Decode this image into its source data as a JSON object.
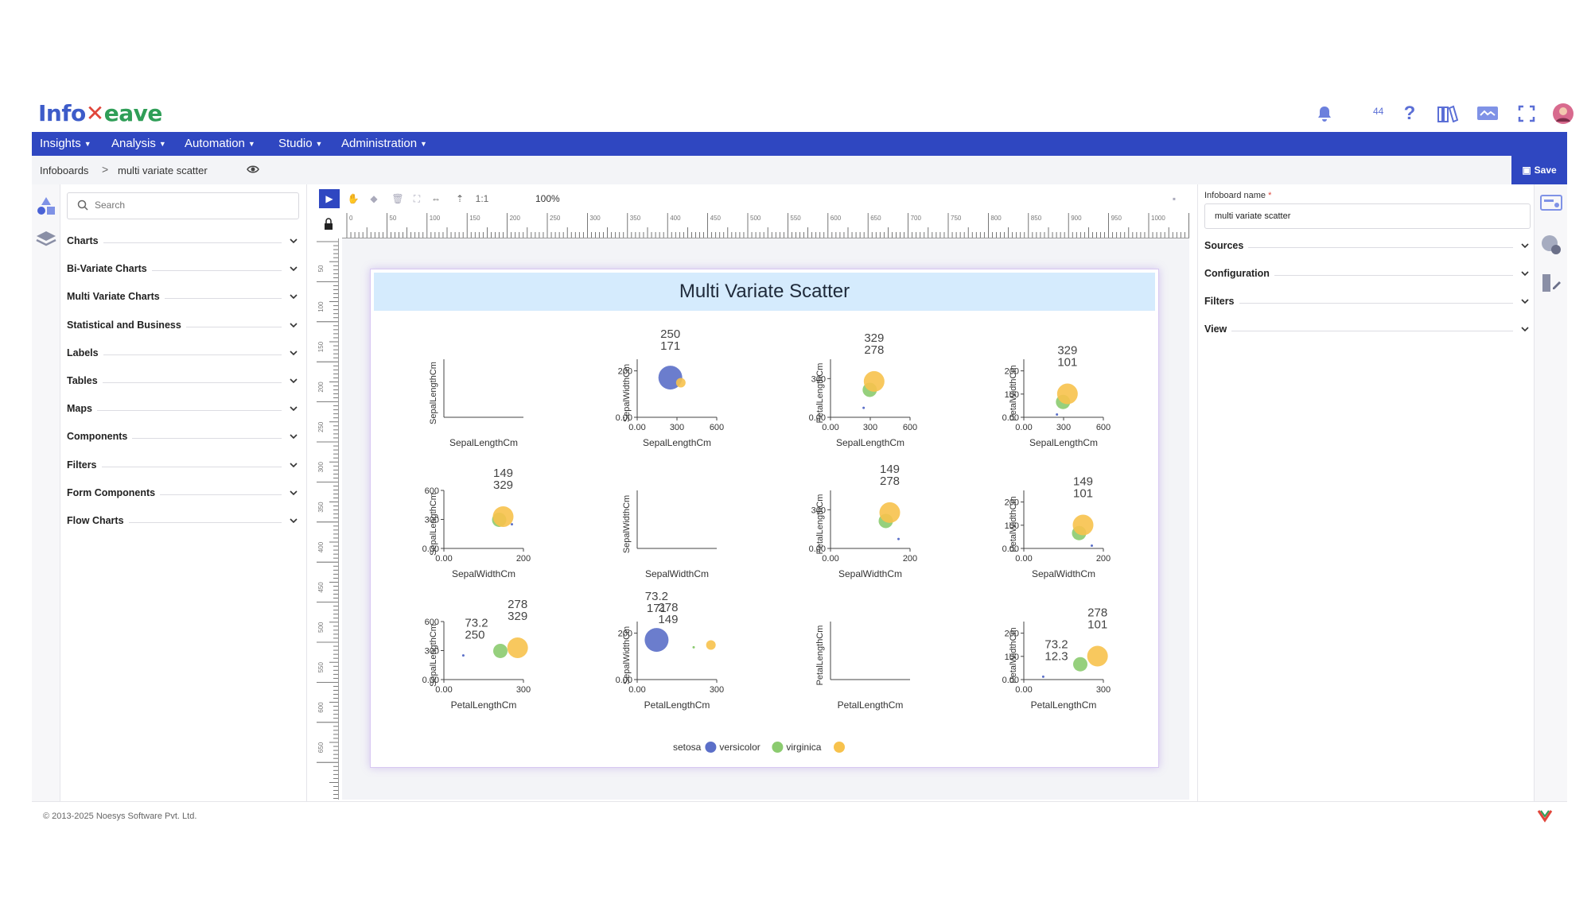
{
  "app": {
    "logo_text_1": "Info",
    "logo_text_2": "eave",
    "notification_count": "44"
  },
  "menu": [
    {
      "label": "Insights"
    },
    {
      "label": "Analysis"
    },
    {
      "label": "Automation"
    },
    {
      "label": "Studio"
    },
    {
      "label": "Administration"
    }
  ],
  "breadcrumb": {
    "root": "Infoboards",
    "separator": ">",
    "current": "multi variate scatter"
  },
  "save_label": "Save",
  "left_panel": {
    "search_placeholder": "Search",
    "categories": [
      "Charts",
      "Bi-Variate Charts",
      "Multi Variate Charts",
      "Statistical and Business",
      "Labels",
      "Tables",
      "Maps",
      "Components",
      "Filters",
      "Form Components",
      "Flow Charts"
    ]
  },
  "toolbar": {
    "ratio_label": "1:1",
    "zoom": "100%"
  },
  "rulers": {
    "h_ticks": [
      "0",
      "50",
      "100",
      "150",
      "200",
      "250",
      "300",
      "350",
      "400",
      "450",
      "500",
      "550",
      "600",
      "650",
      "700",
      "750",
      "800",
      "850",
      "900",
      "950",
      "1000"
    ],
    "v_ticks": [
      "50",
      "100",
      "150",
      "200",
      "250",
      "300",
      "350",
      "400",
      "450",
      "500",
      "550",
      "600",
      "650"
    ]
  },
  "right_panel": {
    "infoboard_name_label": "Infoboard name",
    "required_mark": "*",
    "infoboard_name_value": "multi variate scatter",
    "sections": [
      "Sources",
      "Configuration",
      "Filters",
      "View"
    ]
  },
  "footer": {
    "copyright": "© 2013-2025 Noesys Software Pvt. Ltd."
  },
  "chart_data": {
    "type": "scatter",
    "title": "Multi Variate Scatter",
    "variables": [
      "SepalLengthCm",
      "SepalWidthCm",
      "PetalLengthCm",
      "PetalWidthCm"
    ],
    "colors": {
      "setosa": "#5b6fc8",
      "versicolor": "#8bcb6f",
      "virginica": "#f7c24d"
    },
    "legend": [
      {
        "name": "setosa",
        "color": "#5b6fc8"
      },
      {
        "name": "versicolor",
        "color": "#8bcb6f"
      },
      {
        "name": "virginica",
        "color": "#f7c24d"
      }
    ],
    "panels": [
      {
        "row": 0,
        "col": 0,
        "xlabel": "SepalLengthCm",
        "ylabel": "SepalLengthCm",
        "empty": true
      },
      {
        "row": 0,
        "col": 1,
        "xlabel": "SepalLengthCm",
        "ylabel": "SepalWidthCm",
        "xticks": [
          "0.00",
          "300",
          "600"
        ],
        "yticks": [
          "0.00",
          "200"
        ],
        "xlim": [
          0,
          600
        ],
        "ylim": [
          0,
          250
        ],
        "labels": [
          "250",
          "171"
        ],
        "points": [
          {
            "species": "setosa",
            "x": 250,
            "y": 171,
            "r": 15
          },
          {
            "species": "virginica",
            "x": 329,
            "y": 149,
            "r": 6
          }
        ]
      },
      {
        "row": 0,
        "col": 2,
        "xlabel": "SepalLengthCm",
        "ylabel": "PetalLengthCm",
        "xticks": [
          "0.00",
          "300",
          "600"
        ],
        "yticks": [
          "0.00",
          "300"
        ],
        "xlim": [
          0,
          600
        ],
        "ylim": [
          0,
          450
        ],
        "labels": [
          "329",
          "278"
        ],
        "points": [
          {
            "species": "versicolor",
            "x": 296,
            "y": 213,
            "r": 9
          },
          {
            "species": "virginica",
            "x": 329,
            "y": 278,
            "r": 13
          },
          {
            "species": "setosa",
            "x": 250,
            "y": 73,
            "r": 1.5
          }
        ]
      },
      {
        "row": 0,
        "col": 3,
        "xlabel": "SepalLengthCm",
        "ylabel": "PetalWidthCm",
        "xticks": [
          "0.00",
          "300",
          "600"
        ],
        "yticks": [
          "0.00",
          "100",
          "200"
        ],
        "xlim": [
          0,
          600
        ],
        "ylim": [
          0,
          250
        ],
        "labels": [
          "329",
          "101"
        ],
        "points": [
          {
            "species": "versicolor",
            "x": 296,
            "y": 66,
            "r": 9
          },
          {
            "species": "virginica",
            "x": 329,
            "y": 101,
            "r": 13
          },
          {
            "species": "setosa",
            "x": 250,
            "y": 12,
            "r": 1.5
          }
        ]
      },
      {
        "row": 1,
        "col": 0,
        "xlabel": "SepalWidthCm",
        "ylabel": "SepalLengthCm",
        "xticks": [
          "0.00",
          "200"
        ],
        "yticks": [
          "0.00",
          "300",
          "600"
        ],
        "xlim": [
          0,
          200
        ],
        "ylim": [
          0,
          600
        ],
        "labels": [
          "149",
          "329"
        ],
        "points": [
          {
            "species": "versicolor",
            "x": 139,
            "y": 296,
            "r": 9
          },
          {
            "species": "virginica",
            "x": 149,
            "y": 329,
            "r": 13
          },
          {
            "species": "setosa",
            "x": 171,
            "y": 250,
            "r": 1.5
          }
        ]
      },
      {
        "row": 1,
        "col": 1,
        "xlabel": "SepalWidthCm",
        "ylabel": "SepalWidthCm",
        "empty": true
      },
      {
        "row": 1,
        "col": 2,
        "xlabel": "SepalWidthCm",
        "ylabel": "PetalLengthCm",
        "xticks": [
          "0.00",
          "200"
        ],
        "yticks": [
          "0.00",
          "300"
        ],
        "xlim": [
          0,
          200
        ],
        "ylim": [
          0,
          450
        ],
        "labels": [
          "149",
          "278"
        ],
        "points": [
          {
            "species": "versicolor",
            "x": 139,
            "y": 213,
            "r": 9
          },
          {
            "species": "virginica",
            "x": 149,
            "y": 278,
            "r": 13
          },
          {
            "species": "setosa",
            "x": 171,
            "y": 73,
            "r": 1.5
          }
        ]
      },
      {
        "row": 1,
        "col": 3,
        "xlabel": "SepalWidthCm",
        "ylabel": "PetalWidthCm",
        "xticks": [
          "0.00",
          "200"
        ],
        "yticks": [
          "0.00",
          "100",
          "200"
        ],
        "xlim": [
          0,
          200
        ],
        "ylim": [
          0,
          250
        ],
        "labels": [
          "149",
          "101"
        ],
        "points": [
          {
            "species": "versicolor",
            "x": 139,
            "y": 66,
            "r": 9
          },
          {
            "species": "virginica",
            "x": 149,
            "y": 101,
            "r": 13
          },
          {
            "species": "setosa",
            "x": 171,
            "y": 12,
            "r": 1.5
          }
        ]
      },
      {
        "row": 2,
        "col": 0,
        "xlabel": "PetalLengthCm",
        "ylabel": "SepalLengthCm",
        "xticks": [
          "0.00",
          "300"
        ],
        "yticks": [
          "0.00",
          "300",
          "600"
        ],
        "xlim": [
          0,
          300
        ],
        "ylim": [
          0,
          600
        ],
        "labels": [
          "278",
          "329",
          "73.2",
          "250"
        ],
        "points": [
          {
            "species": "versicolor",
            "x": 213,
            "y": 296,
            "r": 9
          },
          {
            "species": "virginica",
            "x": 278,
            "y": 329,
            "r": 13
          },
          {
            "species": "setosa",
            "x": 73.2,
            "y": 250,
            "r": 1.5
          }
        ]
      },
      {
        "row": 2,
        "col": 1,
        "xlabel": "PetalLengthCm",
        "ylabel": "SepalWidthCm",
        "xticks": [
          "0.00",
          "300"
        ],
        "yticks": [
          "0.00",
          "200"
        ],
        "xlim": [
          0,
          300
        ],
        "ylim": [
          0,
          250
        ],
        "labels": [
          "73.2",
          "171",
          "278",
          "149"
        ],
        "points": [
          {
            "species": "setosa",
            "x": 73.2,
            "y": 171,
            "r": 15
          },
          {
            "species": "virginica",
            "x": 278,
            "y": 149,
            "r": 6
          },
          {
            "species": "versicolor",
            "x": 213,
            "y": 139,
            "r": 1.5
          }
        ]
      },
      {
        "row": 2,
        "col": 2,
        "xlabel": "PetalLengthCm",
        "ylabel": "PetalLengthCm",
        "empty": true
      },
      {
        "row": 2,
        "col": 3,
        "xlabel": "PetalLengthCm",
        "ylabel": "PetalWidthCm",
        "xticks": [
          "0.00",
          "300"
        ],
        "yticks": [
          "0.00",
          "100",
          "200"
        ],
        "xlim": [
          0,
          300
        ],
        "ylim": [
          0,
          250
        ],
        "labels": [
          "278",
          "101",
          "73.2",
          "12.3"
        ],
        "points": [
          {
            "species": "versicolor",
            "x": 213,
            "y": 66,
            "r": 9
          },
          {
            "species": "virginica",
            "x": 278,
            "y": 101,
            "r": 13
          },
          {
            "species": "setosa",
            "x": 73.2,
            "y": 12.3,
            "r": 1.5
          }
        ]
      }
    ]
  }
}
